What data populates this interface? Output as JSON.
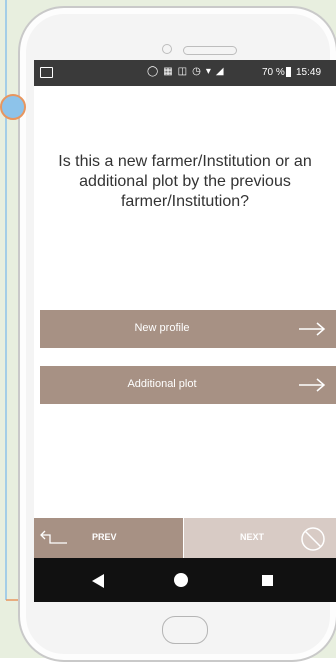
{
  "status_bar": {
    "battery": "70 %",
    "time": "15:49",
    "icons": [
      "image-icon",
      "alarm-sync-icon",
      "nfc-icon",
      "vibrate-icon",
      "alarm-icon",
      "wifi-icon",
      "signal-icon"
    ]
  },
  "question": "Is this a new farmer/Institution or an additional plot by the previous farmer/Institution?",
  "options": [
    {
      "label": "New profile"
    },
    {
      "label": "Additional plot"
    }
  ],
  "nav": {
    "prev_label": "PREV",
    "next_label": "NEXT"
  },
  "colors": {
    "button": "#a79184",
    "button_disabled": "#d8cbc5",
    "background_panel": "#e8efdf",
    "status_bar": "#3a3a3a",
    "nav_bar": "#111111"
  }
}
